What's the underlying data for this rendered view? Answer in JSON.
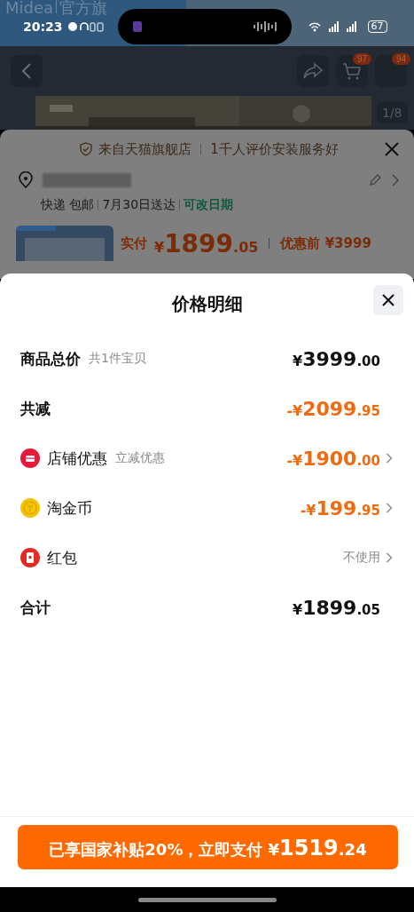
{
  "status_bar": {
    "time": "20:23",
    "battery": "67"
  },
  "store_logo": {
    "brand": "Midea",
    "suffix": "官方旗"
  },
  "nav": {
    "cart_badge": "97",
    "more_badge": "94",
    "image_counter": "1/8"
  },
  "order_sheet": {
    "banner": "来自天猫旗舰店",
    "banner_note": "1千人评价安装服务好",
    "delivery": [
      "快递 包邮",
      "7月30日送达"
    ],
    "change_date": "可改日期",
    "paid_label": "实付",
    "paid_currency": "¥",
    "paid_integer": "1899",
    "paid_decimal": ".05",
    "before_label": "优惠前",
    "before_price": "¥3999"
  },
  "price_detail": {
    "title": "价格明细",
    "rows": [
      {
        "kind": "plain",
        "label": "商品总价",
        "note": "共1件宝贝",
        "prefix": "¥",
        "integer": "3999",
        "decimal": ".00",
        "discount": false,
        "chevron": false
      },
      {
        "kind": "plain",
        "label": "共减",
        "prefix": "-¥",
        "integer": "2099",
        "decimal": ".95",
        "discount": true,
        "chevron": false
      },
      {
        "kind": "shop",
        "label": "店铺优惠",
        "note": "立减优惠",
        "prefix": "-¥",
        "integer": "1900",
        "decimal": ".00",
        "discount": true,
        "chevron": true
      },
      {
        "kind": "coin",
        "label": "淘金币",
        "prefix": "-¥",
        "integer": "199",
        "decimal": ".95",
        "discount": true,
        "chevron": true
      },
      {
        "kind": "redpacket",
        "label": "红包",
        "value": "不使用",
        "chevron": true
      },
      {
        "kind": "plain",
        "label": "合计",
        "prefix": "¥",
        "integer": "1899",
        "decimal": ".05",
        "discount": false,
        "chevron": false
      }
    ]
  },
  "pay_button": {
    "text": "已享国家补贴20%，立即支付",
    "currency": "¥",
    "integer": "1519",
    "decimal": ".24"
  }
}
